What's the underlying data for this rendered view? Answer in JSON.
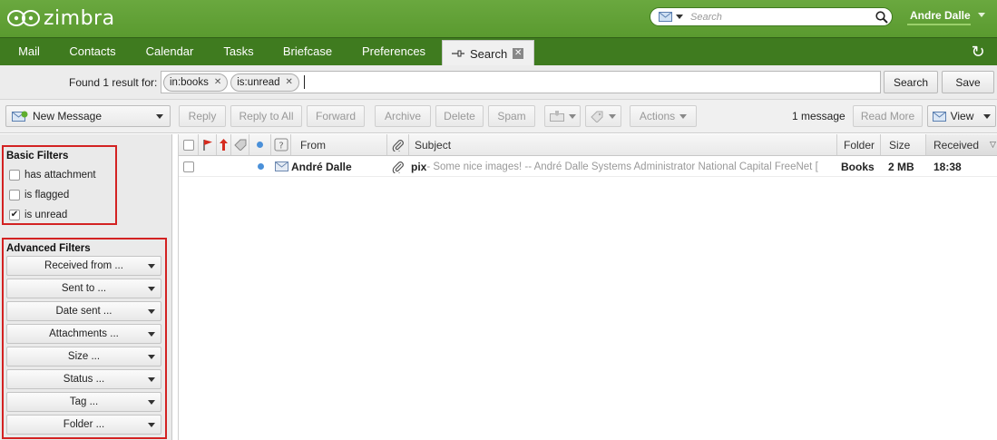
{
  "app": {
    "logo_text": "zimbra"
  },
  "header": {
    "search_placeholder": "Search",
    "user_name": "Andre Dalle"
  },
  "tabs": [
    {
      "label": "Mail"
    },
    {
      "label": "Contacts"
    },
    {
      "label": "Calendar"
    },
    {
      "label": "Tasks"
    },
    {
      "label": "Briefcase"
    },
    {
      "label": "Preferences"
    },
    {
      "label": "Search"
    }
  ],
  "query": {
    "found_label": "Found 1 result for:",
    "chips": [
      "in:books",
      "is:unread"
    ],
    "search_button": "Search",
    "save_button": "Save"
  },
  "toolbar": {
    "new_message": "New Message",
    "reply": "Reply",
    "reply_all": "Reply to All",
    "forward": "Forward",
    "archive": "Archive",
    "delete": "Delete",
    "spam": "Spam",
    "actions": "Actions",
    "message_count": "1 message",
    "read_more": "Read More",
    "view": "View"
  },
  "sidebar": {
    "basic_title": "Basic Filters",
    "basic_filters": [
      {
        "label": "has attachment",
        "checked": false
      },
      {
        "label": "is flagged",
        "checked": false
      },
      {
        "label": "is unread",
        "checked": true
      }
    ],
    "advanced_title": "Advanced Filters",
    "advanced_filters": [
      "Received from ...",
      "Sent to ...",
      "Date sent ...",
      "Attachments ...",
      "Size ...",
      "Status ...",
      "Tag ...",
      "Folder ..."
    ]
  },
  "list": {
    "columns": {
      "from": "From",
      "subject": "Subject",
      "folder": "Folder",
      "size": "Size",
      "received": "Received"
    },
    "rows": [
      {
        "from": "André Dalle",
        "subject": "pix",
        "fragment": " - Some nice images! -- André Dalle Systems Administrator National Capital FreeNet [",
        "folder": "Books",
        "size": "2 MB",
        "received": "18:38"
      }
    ]
  },
  "colors": {
    "header_green": "#5a9a2f",
    "tab_green": "#3f7b1f",
    "filter_box_red": "#d32222",
    "unread_dot": "#4a90d9"
  }
}
